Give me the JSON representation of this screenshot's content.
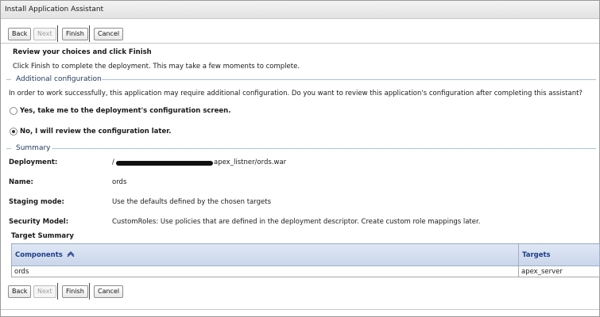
{
  "window": {
    "title": "Install Application Assistant"
  },
  "toolbar": {
    "back": "Back",
    "next": "Next",
    "finish": "Finish",
    "cancel": "Cancel"
  },
  "review": {
    "heading": "Review your choices and click Finish",
    "subtext": "Click Finish to complete the deployment. This may take a few moments to complete."
  },
  "additional_config": {
    "title": "Additional configuration",
    "prompt": "In order to work successfully, this application may require additional configuration. Do you want to review this application's configuration after completing this assistant?",
    "options": [
      {
        "label": "Yes, take me to the deployment's configuration screen.",
        "selected": false
      },
      {
        "label": "No, I will review the configuration later.",
        "selected": true
      }
    ]
  },
  "summary": {
    "title": "Summary",
    "rows": [
      {
        "label": "Deployment:",
        "value_prefix": "/",
        "value": "apex_listner/ords.war"
      },
      {
        "label": "Name:",
        "value": "ords"
      },
      {
        "label": "Staging mode:",
        "value": "Use the defaults defined by the chosen targets"
      },
      {
        "label": "Security Model:",
        "value": "CustomRoles: Use policies that are defined in the deployment descriptor. Create custom role mappings later."
      }
    ]
  },
  "target_summary": {
    "title": "Target Summary",
    "columns": [
      "Components",
      "Targets"
    ],
    "sort_icon": "sort-ascending-icon",
    "rows": [
      {
        "component": "ords",
        "target": "apex_server"
      }
    ]
  },
  "colors": {
    "section_title": "#1f3a5c",
    "table_header_text": "#1f3f8a",
    "table_header_bg": "#c9d5ea"
  }
}
